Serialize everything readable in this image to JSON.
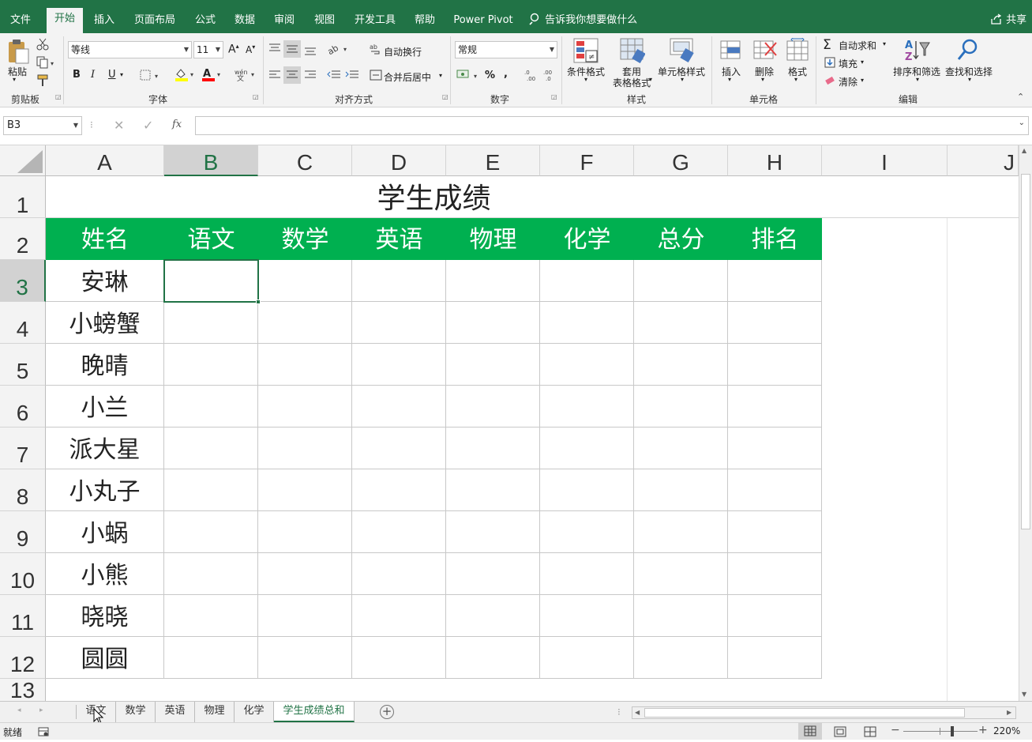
{
  "tabs": [
    {
      "label": "文件",
      "active": false
    },
    {
      "label": "开始",
      "active": true
    },
    {
      "label": "插入",
      "active": false
    },
    {
      "label": "页面布局",
      "active": false
    },
    {
      "label": "公式",
      "active": false
    },
    {
      "label": "数据",
      "active": false
    },
    {
      "label": "审阅",
      "active": false
    },
    {
      "label": "视图",
      "active": false
    },
    {
      "label": "开发工具",
      "active": false
    },
    {
      "label": "帮助",
      "active": false
    },
    {
      "label": "Power Pivot",
      "active": false
    }
  ],
  "tell_me": "告诉我你想要做什么",
  "share": "共享",
  "ribbon": {
    "clipboard": {
      "paste": "粘贴",
      "label": "剪贴板"
    },
    "font": {
      "name": "等线",
      "size": "11",
      "label": "字体"
    },
    "alignment": {
      "wrap": "自动换行",
      "merge": "合并后居中",
      "label": "对齐方式"
    },
    "number": {
      "format": "常规",
      "label": "数字"
    },
    "styles": {
      "conditional": "条件格式",
      "table_fmt_1": "套用",
      "table_fmt_2": "表格格式",
      "cell_styles": "单元格样式",
      "label": "样式"
    },
    "cells": {
      "insert": "插入",
      "delete": "删除",
      "format": "格式",
      "label": "单元格"
    },
    "editing": {
      "autosum": "自动求和",
      "fill": "填充",
      "clear": "清除",
      "sort": "排序和筛选",
      "find": "查找和选择",
      "label": "编辑"
    }
  },
  "name_box": "B3",
  "fx": "fx",
  "columns": [
    "A",
    "B",
    "C",
    "D",
    "E",
    "F",
    "G",
    "H",
    "I",
    "J"
  ],
  "rows": [
    "1",
    "2",
    "3",
    "4",
    "5",
    "6",
    "7",
    "8",
    "9",
    "10",
    "11",
    "12",
    "13"
  ],
  "selected_cell": {
    "col": "B",
    "row": "3"
  },
  "sheet": {
    "title": "学生成绩",
    "headers": [
      "姓名",
      "语文",
      "数学",
      "英语",
      "物理",
      "化学",
      "总分",
      "排名"
    ],
    "names": [
      "安琳",
      "小螃蟹",
      "晚晴",
      "小兰",
      "派大星",
      "小丸子",
      "小蜗",
      "小熊",
      "晓晓",
      "圆圆"
    ]
  },
  "sheet_tabs": [
    {
      "label": "语文",
      "active": false
    },
    {
      "label": "数学",
      "active": false
    },
    {
      "label": "英语",
      "active": false
    },
    {
      "label": "物理",
      "active": false
    },
    {
      "label": "化学",
      "active": false
    },
    {
      "label": "学生成绩总和",
      "active": true
    }
  ],
  "status": {
    "ready": "就绪",
    "zoom": "220%"
  },
  "colors": {
    "brand": "#217346",
    "header_fill": "#00b050"
  }
}
